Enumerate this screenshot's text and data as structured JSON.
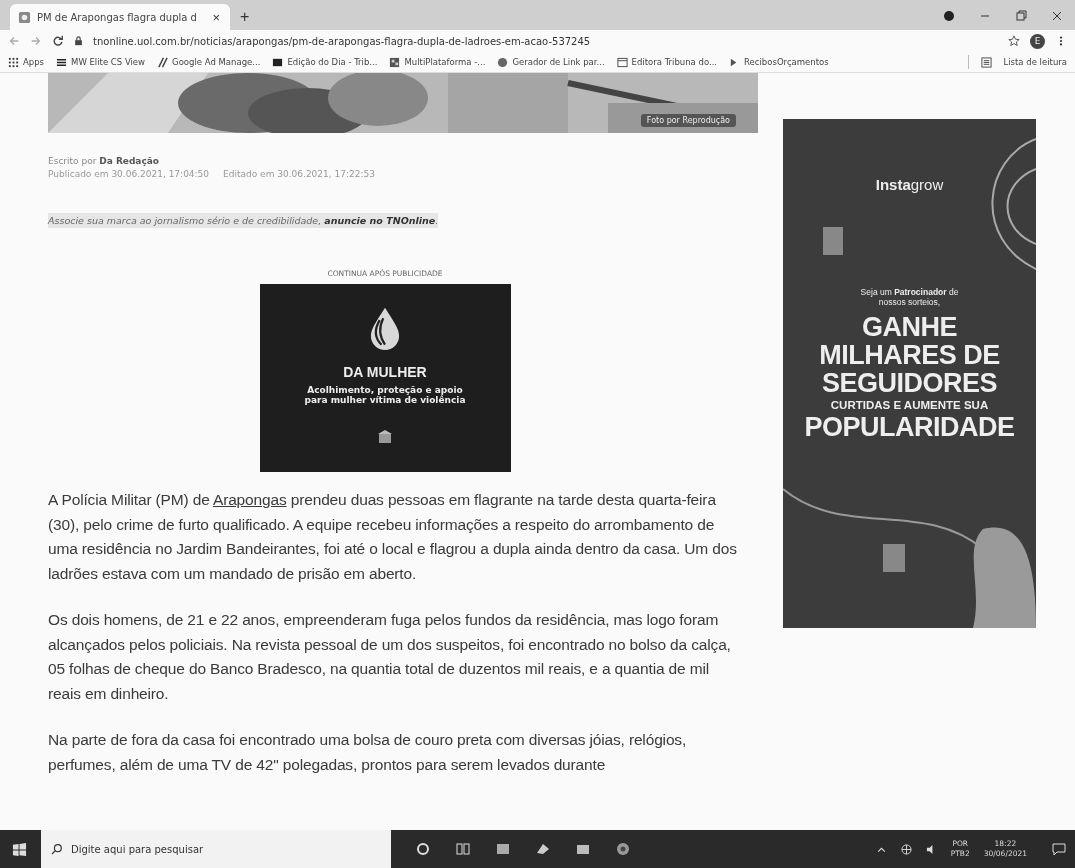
{
  "tab": {
    "title": "PM de Arapongas flagra dupla d",
    "close": "×",
    "new_tab": "+"
  },
  "address_bar": {
    "url": "tnonline.uol.com.br/noticias/arapongas/pm-de-arapongas-flagra-dupla-de-ladroes-em-acao-537245",
    "profile": "E"
  },
  "bookmarks": [
    {
      "label": "Apps",
      "kind": "grid"
    },
    {
      "label": "MW Elite CS View",
      "kind": "logo"
    },
    {
      "label": "Google Ad Manage...",
      "kind": "slash"
    },
    {
      "label": "Edição do Dia - Trib...",
      "kind": "square"
    },
    {
      "label": "MultiPlataforma -...",
      "kind": "mosaic"
    },
    {
      "label": "Gerador de Link par...",
      "kind": "circle"
    },
    {
      "label": "Editora Tribuna do...",
      "kind": "calendar"
    },
    {
      "label": "RecibosOrçamentos",
      "kind": "arrow"
    }
  ],
  "reading_list": "Lista de leitura",
  "article": {
    "photo": {
      "caption": "Foto por Reprodução"
    },
    "author": "Escrito por **Da Redação**",
    "published": "Publicado em 30.06.2021, 17:04:50",
    "edited": "Editado em 30.06.2021, 17:22:53",
    "promo": "Associe sua marca ao jornalismo sério e de credibilidade, **anuncie no TNOnline**.",
    "ad_label": "CONTINUA APÓS PUBLICIDADE",
    "ad": {
      "title": "DA MULHER",
      "subtitle": "Acolhimento, proteção e apoio para mulher vítima de violência"
    },
    "paragraphs": [
      {
        "before": "A Polícia Militar (PM) de ",
        "link": "Arapongas",
        "after": " prendeu duas pessoas em flagrante na tarde desta quarta-feira (30), pelo crime de furto qualificado. A equipe recebeu informações a respeito do arrombamento de uma residência no Jardim Bandeirantes, foi até o local e flagrou a dupla ainda dentro da casa. Um dos ladrões estava com um mandado de prisão em aberto."
      },
      {
        "before": "Os dois homens, de 21 e 22 anos, empreenderam fuga pelos fundos da residência, mas logo foram alcançados pelos policiais. Na revista pessoal de um dos suspeitos, foi encontrado no bolso da calça, 05 folhas de cheque do Banco Bradesco, na quantia total de duzentos mil reais, e a quantia de mil reais em dinheiro."
      },
      {
        "before": "Na parte de fora da casa foi encontrado uma bolsa de couro preta com diversas jóias, relógios, perfumes, além de uma TV de 42\" polegadas, prontos para serem levados durante"
      }
    ]
  },
  "side_ad": {
    "brand": "**Insta**grow",
    "intro": "Seja um **Patrocinador** de nossos sorteios,",
    "headline": [
      "GANHE",
      "MILHARES DE",
      "SEGUIDORES"
    ],
    "subline": "CURTIDAS E AUMENTE SUA",
    "last": "POPULARIDADE"
  },
  "taskbar": {
    "search": "Digite aqui para pesquisar",
    "lang": "POR",
    "layout": "PTB2",
    "time": "18:22",
    "date": "30/06/2021"
  }
}
